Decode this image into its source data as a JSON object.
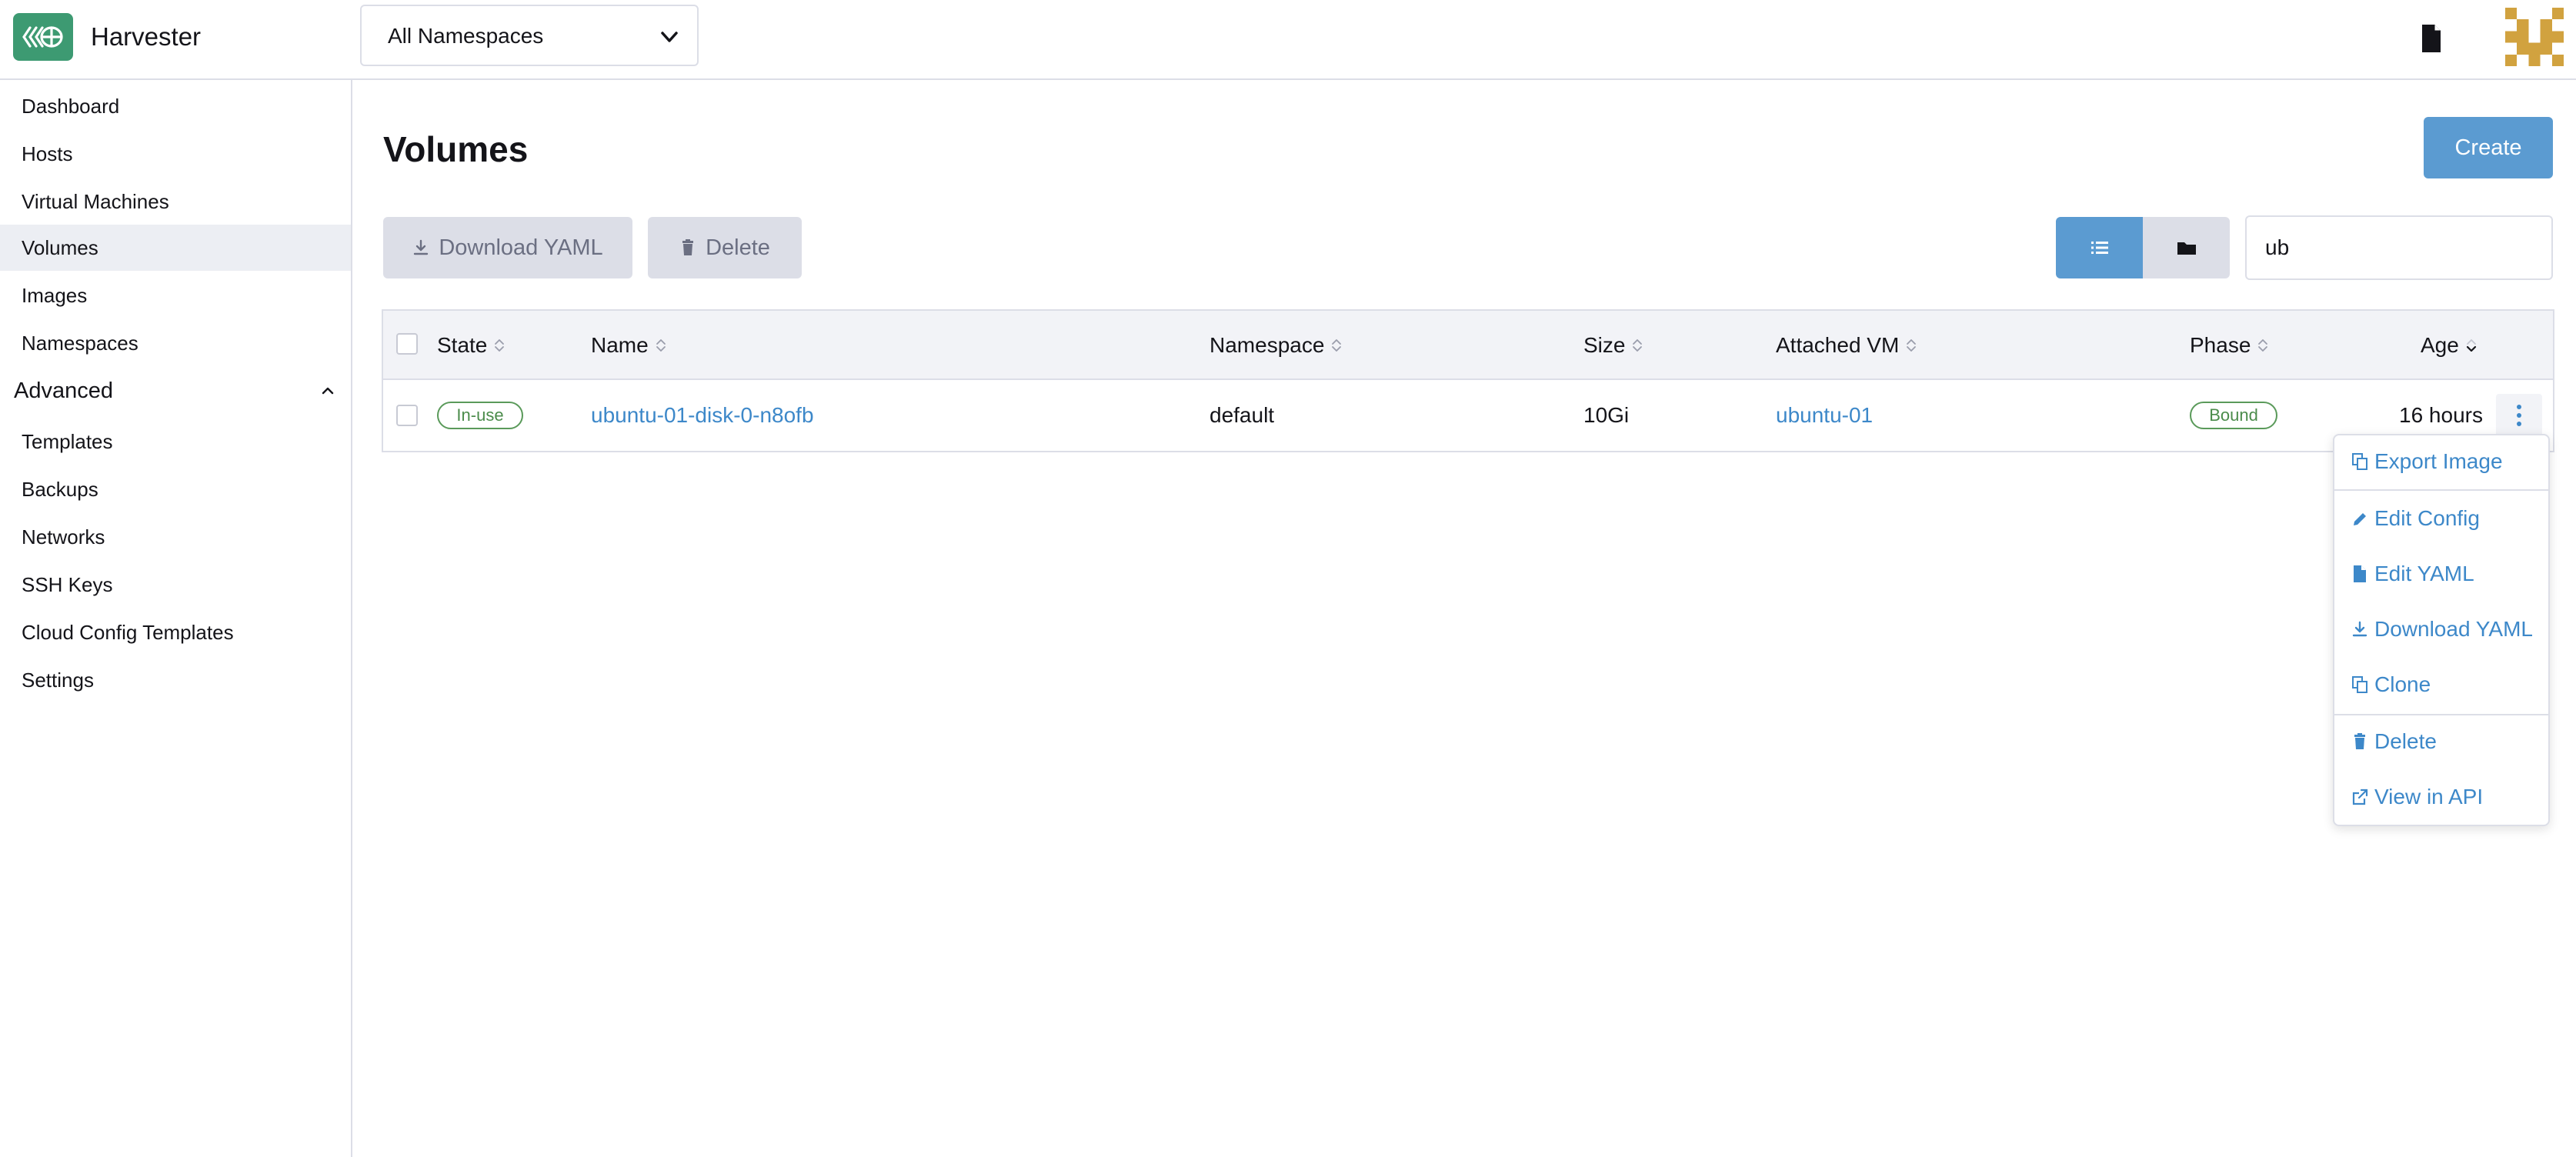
{
  "app": {
    "name": "Harvester",
    "namespace_select": "All Namespaces"
  },
  "sidebar": {
    "items": [
      {
        "label": "Dashboard"
      },
      {
        "label": "Hosts"
      },
      {
        "label": "Virtual Machines"
      },
      {
        "label": "Volumes",
        "active": true
      },
      {
        "label": "Images"
      },
      {
        "label": "Namespaces"
      }
    ],
    "advanced": {
      "label": "Advanced",
      "expanded": true,
      "items": [
        {
          "label": "Templates"
        },
        {
          "label": "Backups"
        },
        {
          "label": "Networks"
        },
        {
          "label": "SSH Keys"
        },
        {
          "label": "Cloud Config Templates"
        },
        {
          "label": "Settings"
        }
      ]
    }
  },
  "page": {
    "title": "Volumes",
    "create_label": "Create"
  },
  "toolbar": {
    "download_yaml_label": "Download YAML",
    "delete_label": "Delete",
    "search_value": "ub"
  },
  "table": {
    "headers": {
      "state": "State",
      "name": "Name",
      "namespace": "Namespace",
      "size": "Size",
      "attached_vm": "Attached VM",
      "phase": "Phase",
      "age": "Age"
    },
    "rows": [
      {
        "state": "In-use",
        "name": "ubuntu-01-disk-0-n8ofb",
        "namespace": "default",
        "size": "10Gi",
        "attached_vm": "ubuntu-01",
        "phase": "Bound",
        "age": "16 hours"
      }
    ]
  },
  "action_menu": {
    "export_image": "Export Image",
    "edit_config": "Edit Config",
    "edit_yaml": "Edit YAML",
    "download_yaml": "Download YAML",
    "clone": "Clone",
    "delete": "Delete",
    "view_in_api": "View in API"
  },
  "colors": {
    "brand_green": "#3d9a72",
    "primary_blue": "#5b9bd1",
    "link_blue": "#3d88c9",
    "badge_green": "#4b8c4b",
    "border": "#dcdee7",
    "avatar_gold": "#d1a23f"
  }
}
